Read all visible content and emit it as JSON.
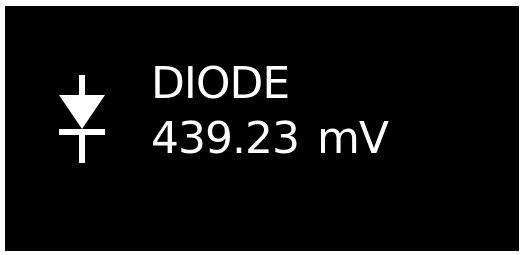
{
  "display": {
    "mode_icon": "diode-icon",
    "mode_label": "DIODE",
    "value": "439.23",
    "unit": "mV",
    "colors": {
      "background": "#000000",
      "foreground": "#ffffff",
      "frame": "#ffffff"
    }
  }
}
